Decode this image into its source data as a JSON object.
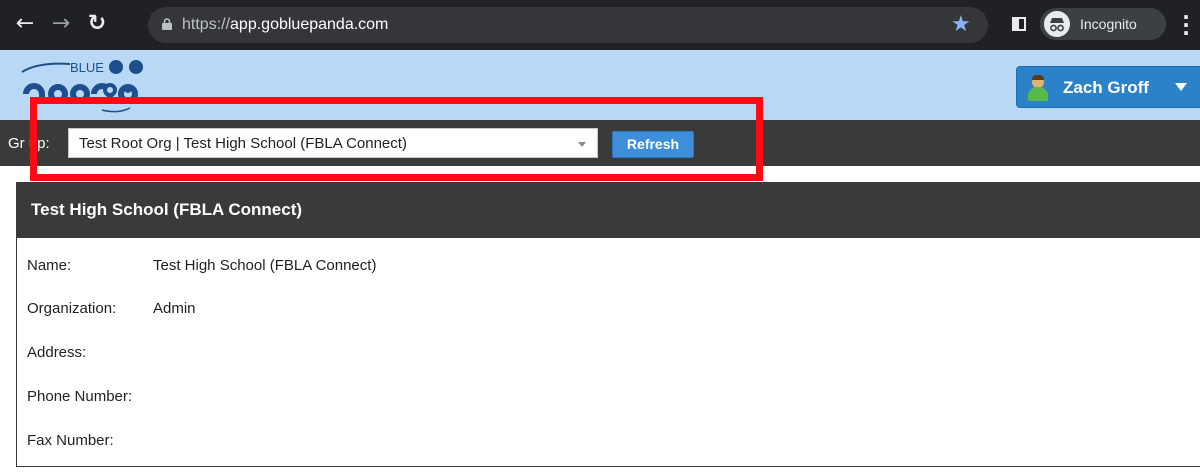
{
  "browser": {
    "url_scheme": "https://",
    "url_host": "app.gobluepanda.com",
    "profile_label": "Incognito",
    "accent_color": "#8ab4f8"
  },
  "header": {
    "logo_text": "BLUE",
    "user_name": "Zach Groff",
    "background_color": "#b9d8f6",
    "user_button_color": "#2c82c9"
  },
  "group_bar": {
    "label": "Gr up:",
    "selected_group": "Test Root Org | Test High School (FBLA Connect)",
    "refresh_label": "Refresh"
  },
  "panel": {
    "title": "Test High School (FBLA Connect)",
    "fields": [
      {
        "label": "Name:",
        "value": "Test High School (FBLA Connect)"
      },
      {
        "label": "Organization:",
        "value": "Admin"
      },
      {
        "label": "Address:",
        "value": ""
      },
      {
        "label": "Phone Number:",
        "value": ""
      },
      {
        "label": "Fax Number:",
        "value": ""
      }
    ]
  },
  "annotation": {
    "highlight_color": "#ff0a14"
  }
}
